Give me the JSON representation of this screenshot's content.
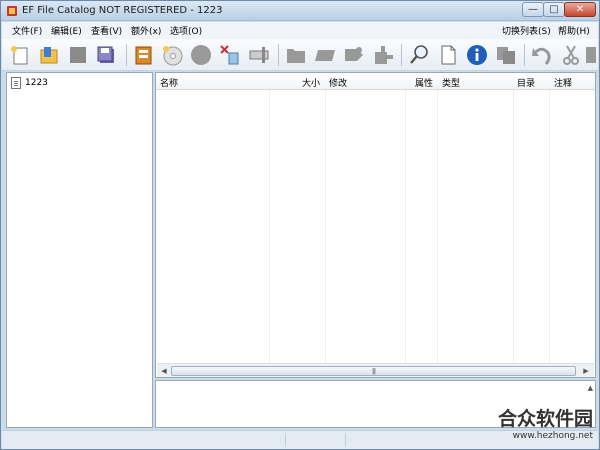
{
  "window": {
    "title": "EF File Catalog NOT REGISTERED - 1223",
    "buttons": {
      "minimize": "—",
      "maximize": "□",
      "close": "✕"
    }
  },
  "menubar": {
    "items": [
      "文件(F)",
      "编辑(E)",
      "查看(V)",
      "额外(x)",
      "选项(O)"
    ],
    "right_item": "切换列表(S)",
    "help": "帮助(H)"
  },
  "toolbar": {
    "buttons": [
      "new-catalog-icon",
      "open-folder-icon",
      "stop-icon",
      "save-icon",
      "catalog-book-icon",
      "disc-icon",
      "record-icon",
      "delete-icon",
      "scanner-icon",
      "folder-gray-icon",
      "eraser-icon",
      "tag-icon",
      "puzzle-add-icon",
      "search-icon",
      "document-icon",
      "info-icon",
      "copy-icon",
      "undo-icon",
      "cut-icon",
      "more-icon"
    ]
  },
  "tree": {
    "items": [
      {
        "label": "1223"
      }
    ]
  },
  "file_list": {
    "columns": [
      "名称",
      "大小",
      "修改",
      "属性",
      "类型",
      "目录",
      "注释"
    ],
    "rows": []
  },
  "watermark": {
    "main": "合众软件园",
    "sub": "www.hezhong.net"
  }
}
